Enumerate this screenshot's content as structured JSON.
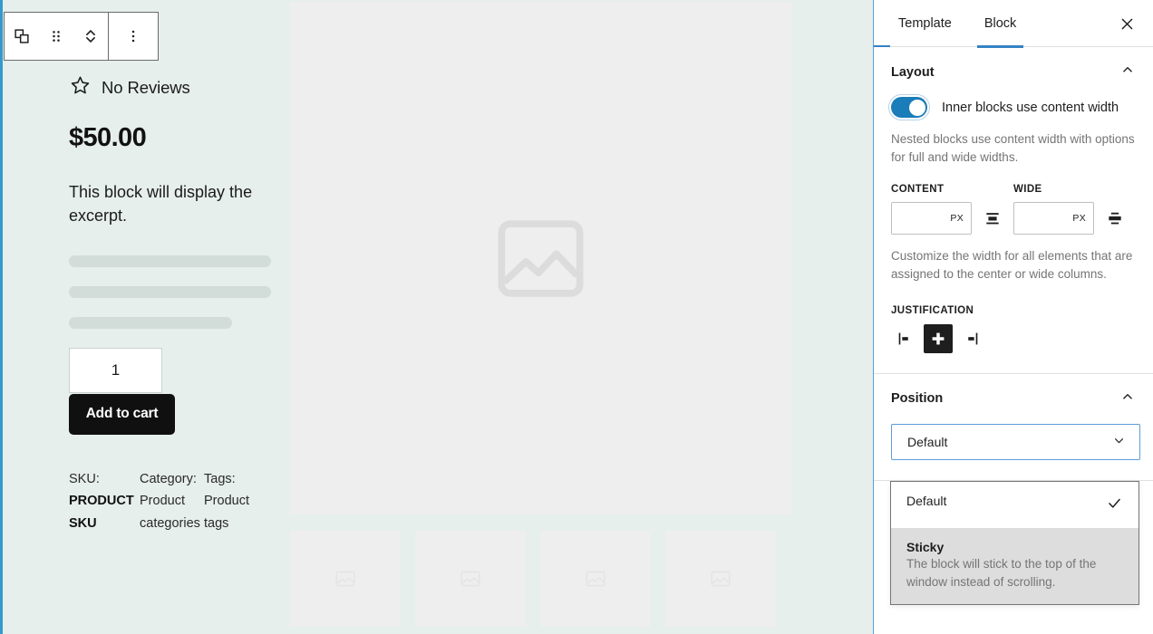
{
  "block_toolbar": {
    "buttons": [
      {
        "name": "block-type-icon",
        "label": "Change block type"
      },
      {
        "name": "drag-handle-icon",
        "label": "Drag"
      },
      {
        "name": "move-up-down-icon",
        "label": "Move up or down"
      },
      {
        "name": "more-options-icon",
        "label": "Options"
      }
    ]
  },
  "product": {
    "reviews_icon": "star-outline-icon",
    "reviews_text": "No Reviews",
    "price": "$50.00",
    "excerpt": "This block will display the excerpt.",
    "quantity_value": "1",
    "add_to_cart_label": "Add to cart",
    "meta": [
      {
        "label": "SKU:",
        "value": "PRODUCT SKU",
        "bold": true
      },
      {
        "label": "Category:",
        "value": "Product categories",
        "bold": false
      },
      {
        "label": "Tags:",
        "value": "Product tags",
        "bold": false
      }
    ],
    "gallery": {
      "main_image_placeholder": "image-placeholder-icon",
      "thumbnail_count": 4
    }
  },
  "sidebar": {
    "tabs": [
      {
        "label": "Template",
        "active": false
      },
      {
        "label": "Block",
        "active": true
      }
    ],
    "close_label": "Close settings",
    "layout": {
      "title": "Layout",
      "toggle_on": true,
      "toggle_label": "Inner blocks use content width",
      "help_text": "Nested blocks use content width with options for full and wide widths.",
      "content_label": "CONTENT",
      "wide_label": "WIDE",
      "content_value": "",
      "content_placeholder": "",
      "content_unit": "PX",
      "wide_value": "",
      "wide_placeholder": "",
      "wide_unit": "PX",
      "width_help": "Customize the width for all elements that are assigned to the center or wide columns.",
      "justification_label": "JUSTIFICATION",
      "justification_options": [
        {
          "name": "justify-left-icon",
          "label": "Justify items left",
          "active": false
        },
        {
          "name": "justify-center-icon",
          "label": "Justify items center",
          "active": true
        },
        {
          "name": "justify-right-icon",
          "label": "Justify items right",
          "active": false
        }
      ]
    },
    "position": {
      "title": "Position",
      "selected_value": "Default",
      "options": [
        {
          "title": "Default",
          "desc": "",
          "selected": true,
          "highlight": false
        },
        {
          "title": "Sticky",
          "desc": "The block will stick to the top of the window instead of scrolling.",
          "selected": false,
          "highlight": true
        }
      ]
    }
  },
  "colors": {
    "canvas_bg": "#e6efeb",
    "accent_blue": "#3582c4",
    "toggle_blue": "#1a7cb8",
    "placeholder_gray": "#eeeeee",
    "button_black": "#101010"
  }
}
